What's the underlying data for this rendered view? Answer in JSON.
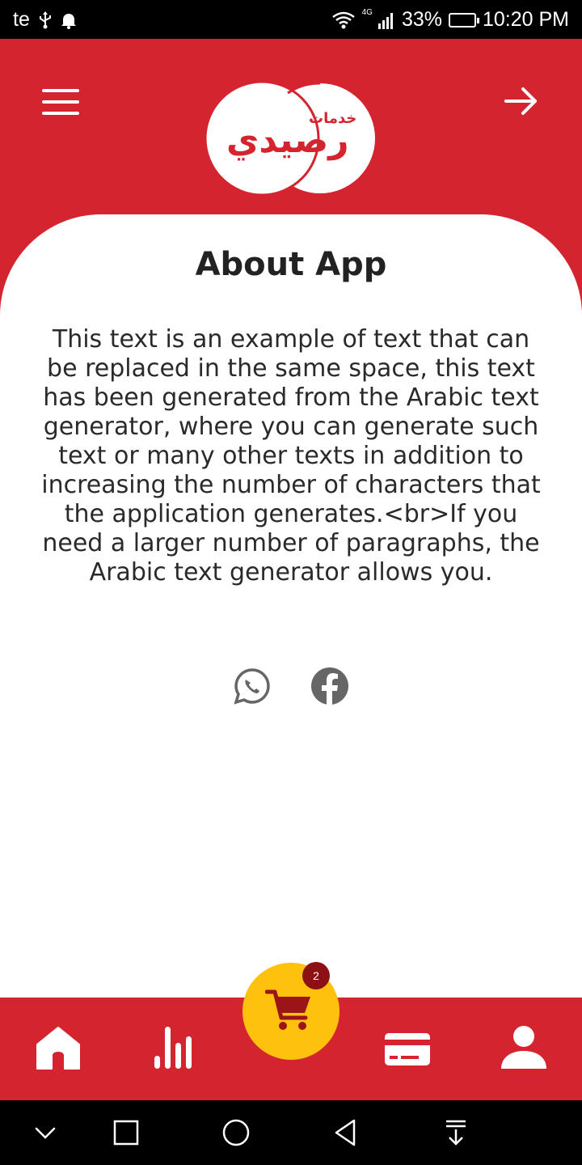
{
  "status_bar": {
    "carrier": "te",
    "network": "4G",
    "battery": "33%",
    "time": "10:20 PM",
    "icons": [
      "usb-icon",
      "notification-bell-icon",
      "wifi-icon",
      "signal-icon",
      "battery-charging-icon"
    ]
  },
  "header": {
    "logo_text_sub": "خدمات",
    "logo_text_main": "رصيدي",
    "menu_icon": "menu-icon",
    "forward_icon": "arrow-right-icon"
  },
  "content": {
    "title": "About App",
    "body": "This text is an example of text that can be replaced in the same space, this text has been generated from the Arabic text generator, where you can generate such text or many other texts in addition to increasing the number of characters that the application generates.<br>If you need a larger number of paragraphs, the Arabic text generator allows you.",
    "social": [
      "whatsapp-icon",
      "facebook-icon"
    ]
  },
  "bottom_nav": {
    "items": [
      "home-icon",
      "stats-icon",
      "cart-icon",
      "card-icon",
      "profile-icon"
    ],
    "cart_badge": "2"
  },
  "colors": {
    "brand_red": "#d42430",
    "cart_yellow": "#fec20e",
    "badge_dark_red": "#8c1014",
    "icon_gray": "#666666"
  }
}
